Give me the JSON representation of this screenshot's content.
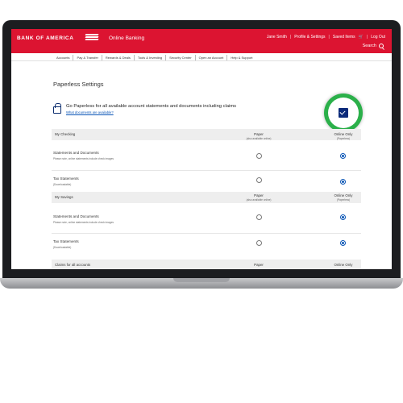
{
  "header": {
    "logo_text": "BANK OF AMERICA",
    "product": "Online Banking",
    "user_name": "Jane Smith",
    "profile_link": "Profile & Settings",
    "saved_items": "Saved Items",
    "logout": "Log Out",
    "search_label": "Search",
    "brand_color": "#dc1431"
  },
  "nav": {
    "items": [
      "Accounts",
      "Pay & Transfer",
      "Rewards & Deals",
      "Tools & Investing",
      "Security Center",
      "Open an Account",
      "Help & Support"
    ]
  },
  "page": {
    "title": "Paperless Settings",
    "promo_text": "Go Paperless for all available account statements and documents including claims",
    "promo_link": "What documents are available?",
    "promo_checked": true
  },
  "sections": [
    {
      "name": "My Checking",
      "paper_label": "Paper",
      "paper_sub": "(also available online)",
      "online_label": "Online Only",
      "online_sub": "(Paperless)",
      "rows": [
        {
          "label": "Statements and Documents",
          "sub": "Please note, online statements include check images",
          "selected": "online"
        },
        {
          "label": "Tax Statements",
          "sub": "(Downloadable)",
          "selected": "online"
        }
      ]
    },
    {
      "name": "My Savings",
      "paper_label": "Paper",
      "paper_sub": "(also available online)",
      "online_label": "Online Only",
      "online_sub": "(Paperless)",
      "rows": [
        {
          "label": "Statements and Documents",
          "sub": "Please note, online statements include check images",
          "selected": "online"
        },
        {
          "label": "Tax Statements",
          "sub": "(Downloadable)",
          "selected": "online"
        }
      ]
    },
    {
      "name": "Claims for all accounts",
      "paper_label": "Paper",
      "online_label": "Online Only"
    }
  ]
}
